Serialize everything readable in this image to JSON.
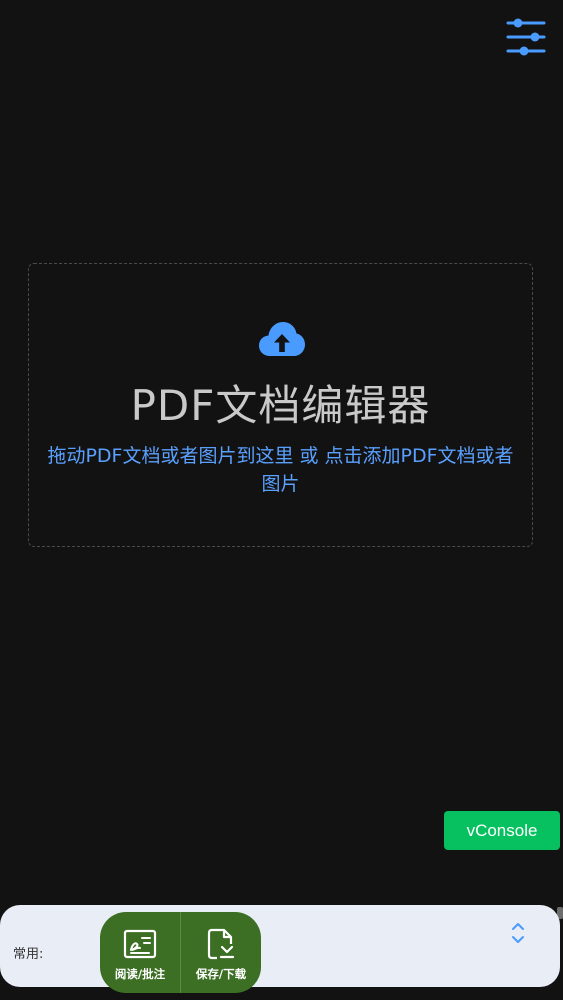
{
  "header": {
    "settings_icon": "sliders-icon"
  },
  "drop_zone": {
    "icon": "cloud-upload-icon",
    "title": "PDF文档编辑器",
    "hint": "拖动PDF文档或者图片到这里 或 点击添加PDF文档或者图片"
  },
  "vconsole": {
    "label": "vConsole"
  },
  "toolbar": {
    "label": "常用:",
    "tools": [
      {
        "label": "阅读/批注",
        "icon": "sign-annotate-icon"
      },
      {
        "label": "保存/下载",
        "icon": "file-download-icon"
      }
    ],
    "expand_icon": "chevron-up-down-icon"
  },
  "colors": {
    "background": "#121212",
    "accent_blue": "#4a9bff",
    "hint_blue": "#5aa0ff",
    "title_gray": "#c9c9c9",
    "vconsole_green": "#07c160",
    "toolbar_bg": "#e9edf5",
    "tool_green": "#3c6e24"
  }
}
